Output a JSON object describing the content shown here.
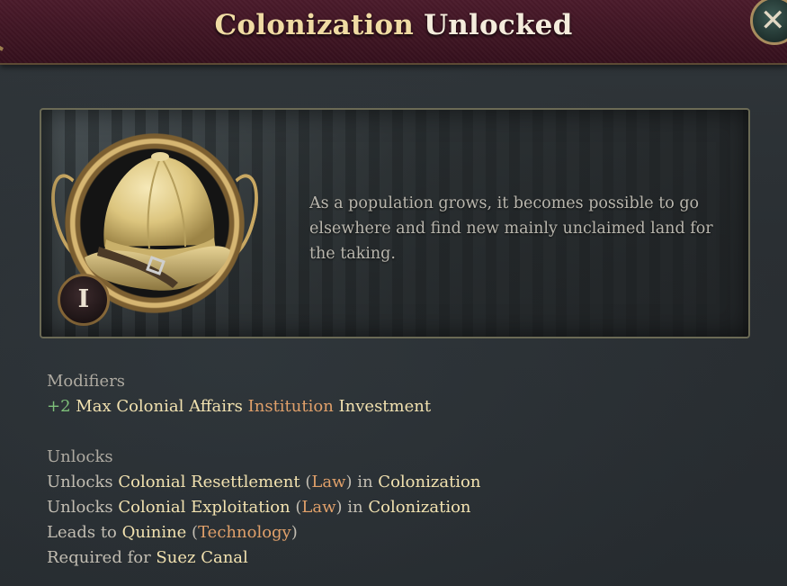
{
  "header": {
    "title_part1": "Colonization",
    "title_part2": "Unlocked",
    "close_symbol": "✕"
  },
  "hero": {
    "level": "I",
    "icon": "pith-helmet-icon",
    "description": "As a population grows, it becomes possible to go elsewhere and find new mainly unclaimed land for the taking."
  },
  "modifiers": {
    "label": "Modifiers",
    "items": [
      {
        "value": "+2",
        "text1": "Max Colonial Affairs",
        "link": "Institution",
        "text2": "Investment"
      }
    ]
  },
  "unlocks": {
    "label": "Unlocks",
    "items": [
      {
        "prefix": "Unlocks",
        "name": "Colonial Resettlement",
        "type": "Law",
        "joiner": "in",
        "target": "Colonization"
      },
      {
        "prefix": "Unlocks",
        "name": "Colonial Exploitation",
        "type": "Law",
        "joiner": "in",
        "target": "Colonization"
      },
      {
        "prefix": "Leads to",
        "name": "Quinine",
        "type": "Technology"
      },
      {
        "prefix": "Required for",
        "name": "Suez Canal"
      }
    ]
  },
  "colors": {
    "header_bg": "#3f1523",
    "title_gold": "#f0dba3",
    "highlight": "#f2e2b0",
    "link_orange": "#e0a06a",
    "positive_green": "#7ec07a"
  }
}
